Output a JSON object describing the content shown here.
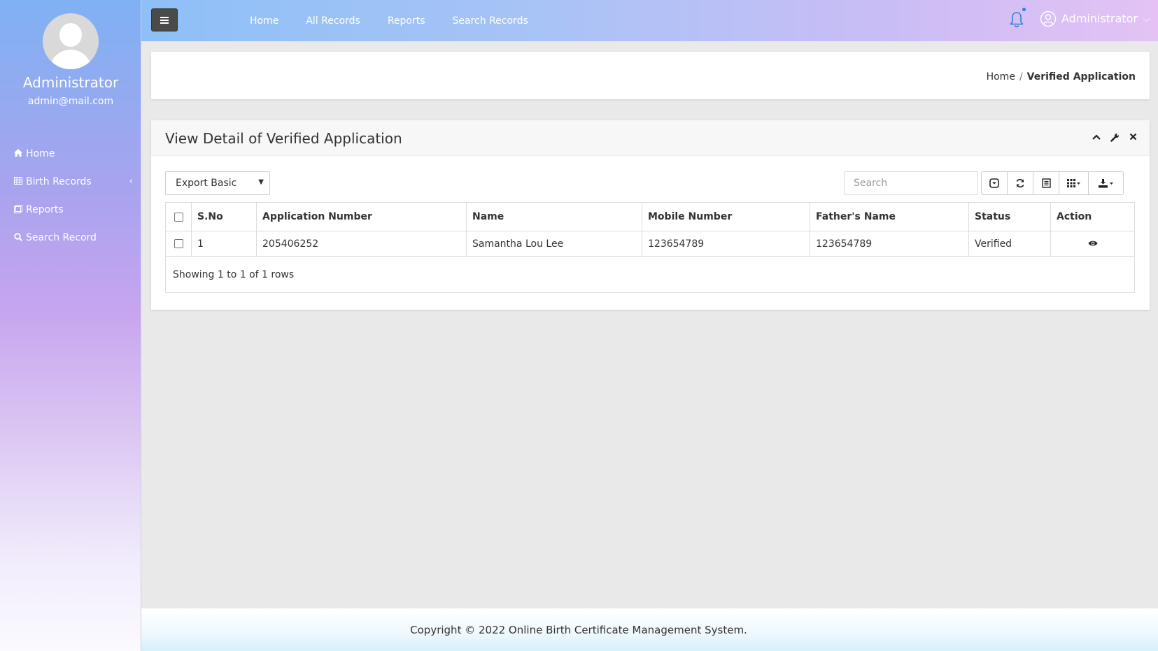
{
  "sidebar": {
    "user_name": "Administrator",
    "user_email": "admin@mail.com",
    "items": [
      {
        "label": "Home",
        "icon": "home-icon"
      },
      {
        "label": "Birth Records",
        "icon": "table-icon"
      },
      {
        "label": "Reports",
        "icon": "report-icon"
      },
      {
        "label": "Search Record",
        "icon": "search-icon"
      }
    ]
  },
  "topbar": {
    "nav": [
      "Home",
      "All Records",
      "Reports",
      "Search Records"
    ],
    "user_name": "Administrator"
  },
  "breadcrumb": {
    "home": "Home",
    "separator": "/",
    "current": "Verified Application"
  },
  "card": {
    "title": "View Detail of Verified Application",
    "export_option": "Export Basic",
    "search_placeholder": "Search",
    "columns": [
      "S.No",
      "Application Number",
      "Name",
      "Mobile Number",
      "Father's Name",
      "Status",
      "Action"
    ],
    "rows": [
      {
        "sno": "1",
        "application_number": "205406252",
        "name": "Samantha Lou Lee",
        "mobile": "123654789",
        "father": "123654789",
        "status": "Verified"
      }
    ],
    "pagination_text": "Showing 1 to 1 of 1 rows"
  },
  "footer": {
    "text": "Copyright © 2022 Online Birth Certificate Management System."
  },
  "colors": {
    "accent": "#8dc0f7",
    "sidebar_purple": "#c7a5ef",
    "hamburger": "#4a4a4a"
  }
}
